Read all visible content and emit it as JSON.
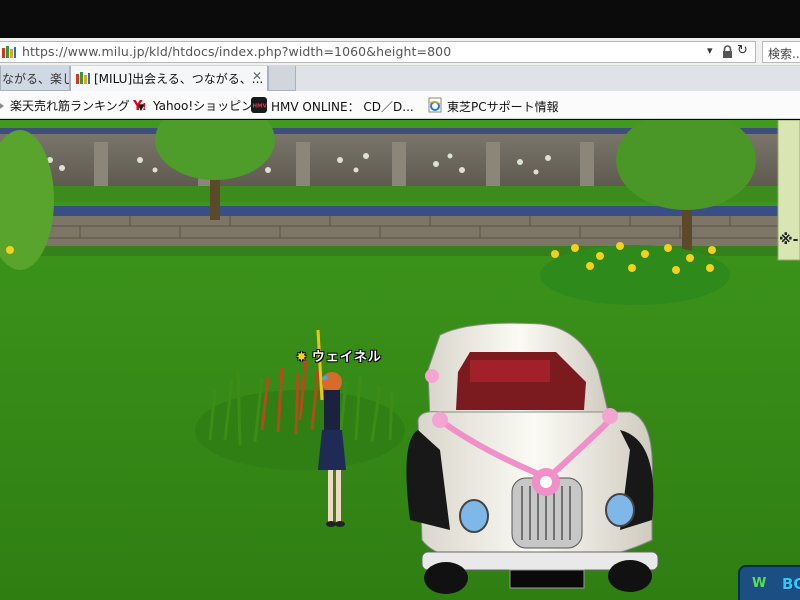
{
  "browser": {
    "address_bar": {
      "url": "https://www.milu.jp/kld/htdocs/index.php?width=1060&height=800",
      "dropdown_glyph": "▾",
      "lock_glyph": "🔒",
      "refresh_glyph": "↻",
      "site_icon": "milu-favicon"
    },
    "search_box": {
      "placeholder": "検索..."
    },
    "tabs": [
      {
        "label": "ながる、楽し...",
        "active": false
      },
      {
        "label": "[MILU]出会える、つながる、...",
        "active": true,
        "close_glyph": "✕"
      },
      {
        "label": "",
        "active": false
      }
    ],
    "favorites": [
      {
        "label": "楽天売れ筋ランキング",
        "icon": "rakuten-icon",
        "dropdown_glyph": "▼"
      },
      {
        "label": "Yahoo!ショッピング",
        "icon": "yahoo-icon"
      },
      {
        "label": "HMV ONLINE： CD／D...",
        "icon": "hmv-icon"
      },
      {
        "label": "東芝PCサポート情報",
        "icon": "ie-page-icon"
      }
    ]
  },
  "game": {
    "character_name": "ウェイネル",
    "corner_button_text": "BO",
    "corner_button_prefix": "W",
    "side_widget_glyph": "※-",
    "colors": {
      "grass": "#3f9a1e",
      "wall": "#6f6a60",
      "car_body": "#f2f0e8",
      "ribbon": "#f08fc8",
      "seat": "#a1202a"
    }
  }
}
